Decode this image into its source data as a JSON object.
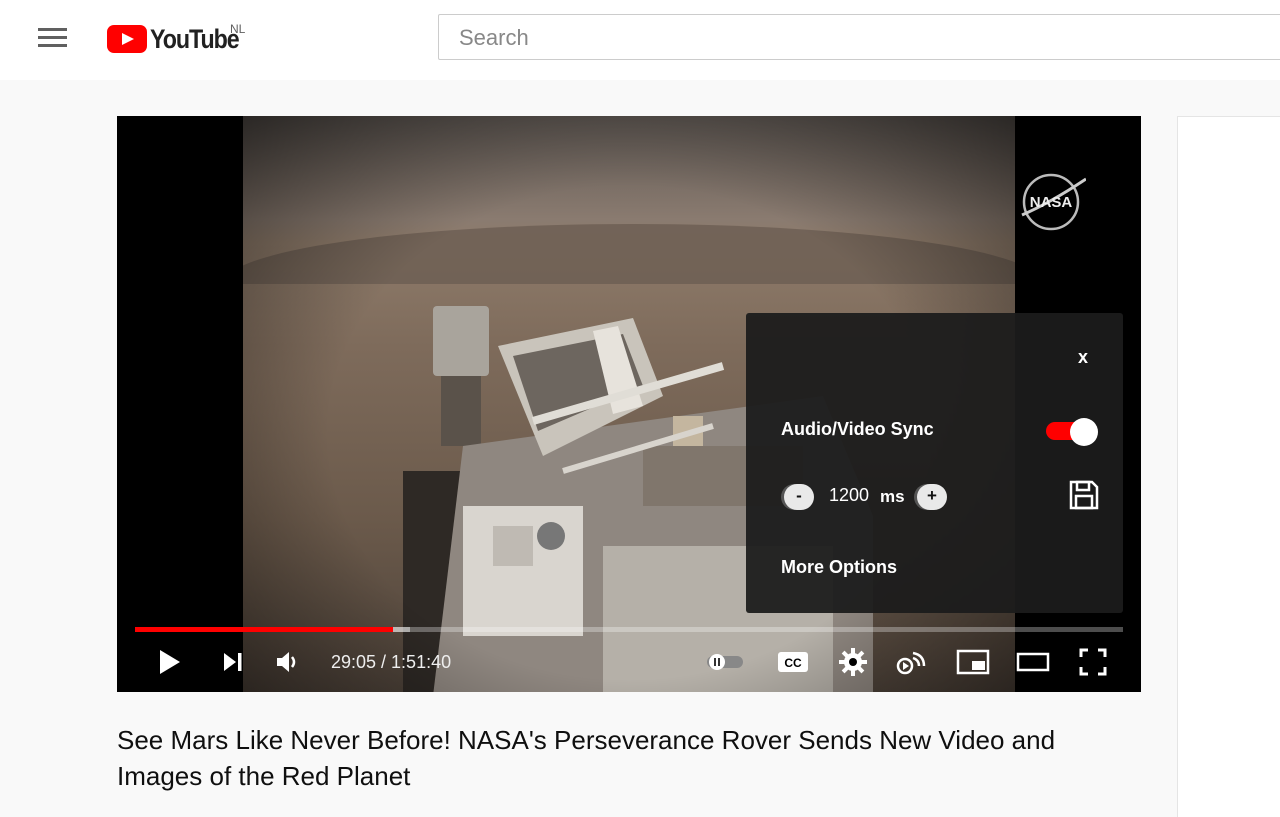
{
  "header": {
    "logo_text": "YouTube",
    "country_code": "NL",
    "search_placeholder": "Search"
  },
  "player": {
    "current_time": "29:05",
    "duration": "1:51:40",
    "time_display": "29:05 / 1:51:40",
    "progress_fraction": 0.261,
    "buffer_fraction": 0.278,
    "watermark": "NASA"
  },
  "sync_panel": {
    "close_label": "x",
    "title": "Audio/Video Sync",
    "toggle_on": true,
    "decrement_label": "-",
    "increment_label": "+",
    "offset_value": "1200",
    "offset_unit": "ms",
    "more_options": "More Options"
  },
  "video": {
    "title": "See Mars Like Never Before! NASA's Perseverance Rover Sends New Video and Images of the Red Planet"
  },
  "colors": {
    "accent": "#ff0000",
    "panel_bg": "#1c1c1c"
  }
}
